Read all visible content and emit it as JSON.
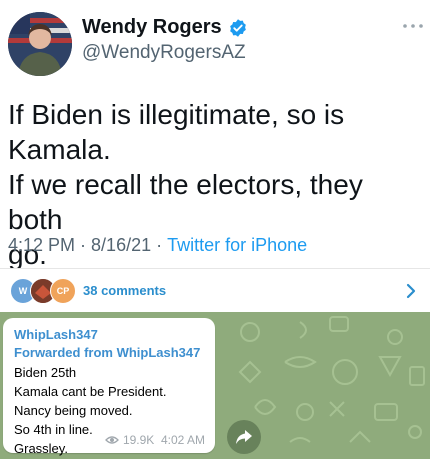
{
  "tweet": {
    "author_name": "Wendy Rogers",
    "author_handle": "@WendyRogersAZ",
    "text_lines": [
      "If Biden is illegitimate, so is Kamala.",
      "If we recall the electors, they both",
      "go."
    ],
    "time": "4:12 PM",
    "date": "8/16/21",
    "separator": " · ",
    "source": "Twitter for iPhone",
    "verified_color": "#1d9bf0"
  },
  "comments": {
    "avatars": [
      {
        "label": "W",
        "color": "#6aa3d9"
      },
      {
        "label": "",
        "color": "#7a3b2a"
      },
      {
        "label": "CP",
        "color": "#f0a35a"
      }
    ],
    "label": "38 comments"
  },
  "message": {
    "from": "WhipLash347",
    "forwarded": "Forwarded from WhipLash347",
    "lines": [
      "Biden 25th",
      "Kamala cant be President.",
      "Nancy being moved.",
      "So 4th in line.",
      "Grassley."
    ],
    "views": "19.9K",
    "time": "4:02 AM"
  },
  "colors": {
    "chat_background": "#8fab7c",
    "link_blue": "#1d9bf0",
    "telegram_blue": "#3e8fcf"
  }
}
